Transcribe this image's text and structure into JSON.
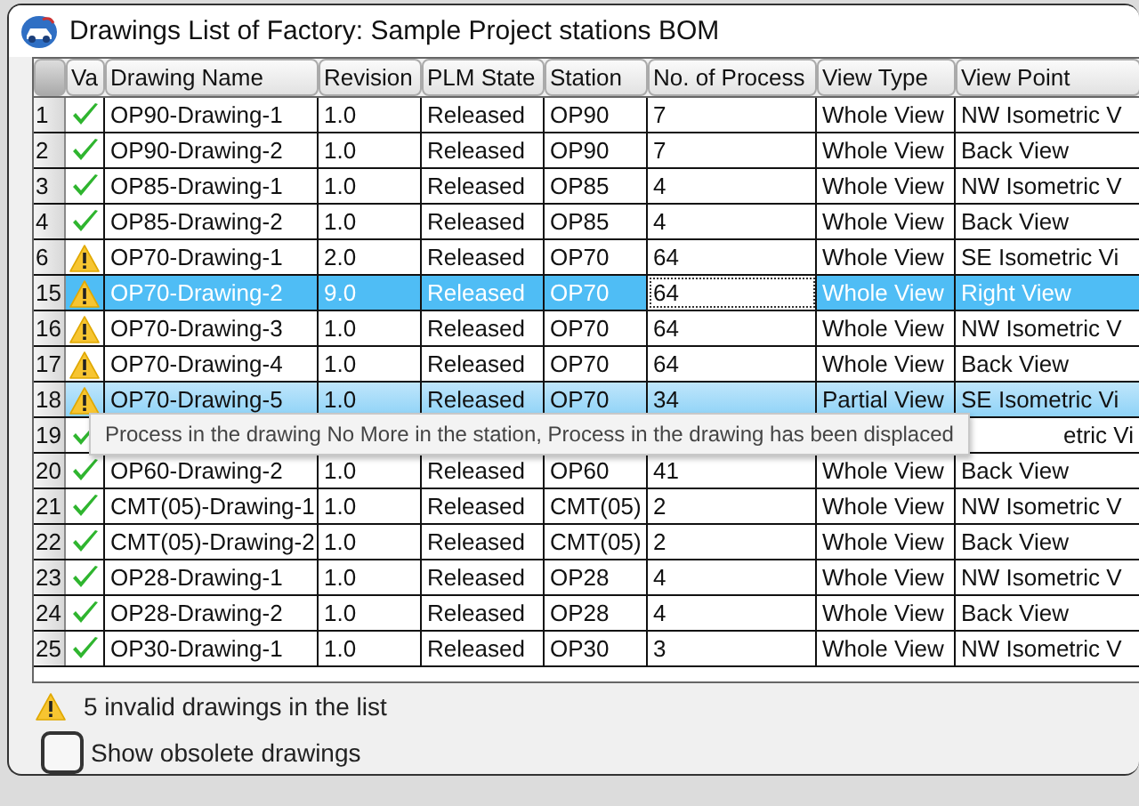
{
  "window": {
    "title": "Drawings List of Factory: Sample Project stations BOM"
  },
  "table": {
    "columns": [
      "Va",
      "Drawing Name",
      "Revision",
      "PLM State",
      "Station",
      "No. of Process",
      "View Type",
      "View Point"
    ],
    "rows": [
      {
        "number": "1",
        "kind": "ok",
        "name": "OP90-Drawing-1",
        "revision": "1.0",
        "plm_state": "Released",
        "station": "OP90",
        "processes": "7",
        "view_type": "Whole View",
        "view_point": "NW Isometric V",
        "selected": false,
        "hovered": false,
        "focused": false
      },
      {
        "number": "2",
        "kind": "ok",
        "name": "OP90-Drawing-2",
        "revision": "1.0",
        "plm_state": "Released",
        "station": "OP90",
        "processes": "7",
        "view_type": "Whole View",
        "view_point": "Back View",
        "selected": false,
        "hovered": false,
        "focused": false
      },
      {
        "number": "3",
        "kind": "ok",
        "name": "OP85-Drawing-1",
        "revision": "1.0",
        "plm_state": "Released",
        "station": "OP85",
        "processes": "4",
        "view_type": "Whole View",
        "view_point": "NW Isometric V",
        "selected": false,
        "hovered": false,
        "focused": false
      },
      {
        "number": "4",
        "kind": "ok",
        "name": "OP85-Drawing-2",
        "revision": "1.0",
        "plm_state": "Released",
        "station": "OP85",
        "processes": "4",
        "view_type": "Whole View",
        "view_point": "Back View",
        "selected": false,
        "hovered": false,
        "focused": false
      },
      {
        "number": "6",
        "kind": "warning",
        "name": "OP70-Drawing-1",
        "revision": "2.0",
        "plm_state": "Released",
        "station": "OP70",
        "processes": "64",
        "view_type": "Whole View",
        "view_point": "SE Isometric Vi",
        "selected": false,
        "hovered": false,
        "focused": false
      },
      {
        "number": "15",
        "kind": "warning",
        "name": "OP70-Drawing-2",
        "revision": "9.0",
        "plm_state": "Released",
        "station": "OP70",
        "processes": "64",
        "view_type": "Whole View",
        "view_point": "Right View",
        "selected": true,
        "hovered": false,
        "focused": true
      },
      {
        "number": "16",
        "kind": "warning",
        "name": "OP70-Drawing-3",
        "revision": "1.0",
        "plm_state": "Released",
        "station": "OP70",
        "processes": "64",
        "view_type": "Whole View",
        "view_point": "NW Isometric V",
        "selected": false,
        "hovered": false,
        "focused": false
      },
      {
        "number": "17",
        "kind": "warning",
        "name": "OP70-Drawing-4",
        "revision": "1.0",
        "plm_state": "Released",
        "station": "OP70",
        "processes": "64",
        "view_type": "Whole View",
        "view_point": "Back View",
        "selected": false,
        "hovered": false,
        "focused": false
      },
      {
        "number": "18",
        "kind": "warning",
        "name": "OP70-Drawing-5",
        "revision": "1.0",
        "plm_state": "Released",
        "station": "OP70",
        "processes": "34",
        "view_type": "Partial View",
        "view_point": "SE Isometric Vi",
        "selected": false,
        "hovered": true,
        "focused": false
      },
      {
        "number": "19",
        "kind": "ok",
        "view_point": "etric Vi",
        "tooltip": "Process in the drawing No More in the station, Process in the drawing has been displaced"
      },
      {
        "number": "20",
        "kind": "ok",
        "name": "OP60-Drawing-2",
        "revision": "1.0",
        "plm_state": "Released",
        "station": "OP60",
        "processes": "41",
        "view_type": "Whole View",
        "view_point": "Back View",
        "selected": false,
        "hovered": false,
        "focused": false
      },
      {
        "number": "21",
        "kind": "ok",
        "name": "CMT(05)-Drawing-1",
        "revision": "1.0",
        "plm_state": "Released",
        "station": "CMT(05)",
        "processes": "2",
        "view_type": "Whole View",
        "view_point": "NW Isometric V",
        "selected": false,
        "hovered": false,
        "focused": false
      },
      {
        "number": "22",
        "kind": "ok",
        "name": "CMT(05)-Drawing-2",
        "revision": "1.0",
        "plm_state": "Released",
        "station": "CMT(05)",
        "processes": "2",
        "view_type": "Whole View",
        "view_point": "Back View",
        "selected": false,
        "hovered": false,
        "focused": false
      },
      {
        "number": "23",
        "kind": "ok",
        "name": "OP28-Drawing-1",
        "revision": "1.0",
        "plm_state": "Released",
        "station": "OP28",
        "processes": "4",
        "view_type": "Whole View",
        "view_point": "NW Isometric V",
        "selected": false,
        "hovered": false,
        "focused": false
      },
      {
        "number": "24",
        "kind": "ok",
        "name": "OP28-Drawing-2",
        "revision": "1.0",
        "plm_state": "Released",
        "station": "OP28",
        "processes": "4",
        "view_type": "Whole View",
        "view_point": "Back View",
        "selected": false,
        "hovered": false,
        "focused": false
      },
      {
        "number": "25",
        "kind": "ok",
        "name": "OP30-Drawing-1",
        "revision": "1.0",
        "plm_state": "Released",
        "station": "OP30",
        "processes": "3",
        "view_type": "Whole View",
        "view_point": "NW Isometric V",
        "selected": false,
        "hovered": false,
        "focused": false
      }
    ]
  },
  "summary": {
    "text": "5 invalid drawings in the list"
  },
  "option": {
    "label": "Show obsolete drawings",
    "checked": false
  }
}
